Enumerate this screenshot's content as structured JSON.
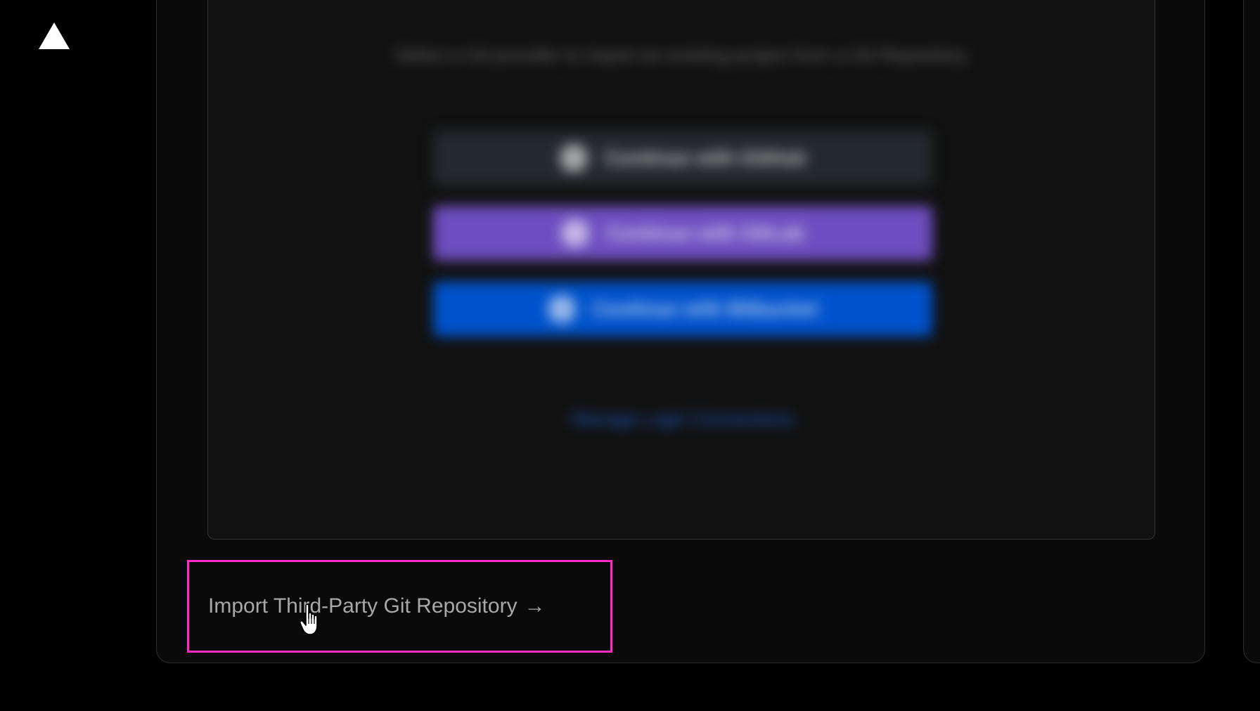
{
  "sidebar": {
    "logo_icon": "vercel-triangle-icon"
  },
  "main": {
    "connect_panel": {
      "description": "Select a Git provider to import an existing project from a Git Repository.",
      "buttons": [
        {
          "label": "Continue with GitHub",
          "icon": "github-icon",
          "color": "#24292e"
        },
        {
          "label": "Continue with GitLab",
          "icon": "gitlab-icon",
          "color": "#6e4ec0"
        },
        {
          "label": "Continue with Bitbucket",
          "icon": "bitbucket-icon",
          "color": "#0052cc"
        }
      ],
      "link": "Manage Login Connections"
    },
    "import_link": {
      "label": "Import Third-Party Git Repository",
      "arrow": "→"
    }
  },
  "colors": {
    "highlight": "#ff2bc2",
    "background": "#000000"
  }
}
